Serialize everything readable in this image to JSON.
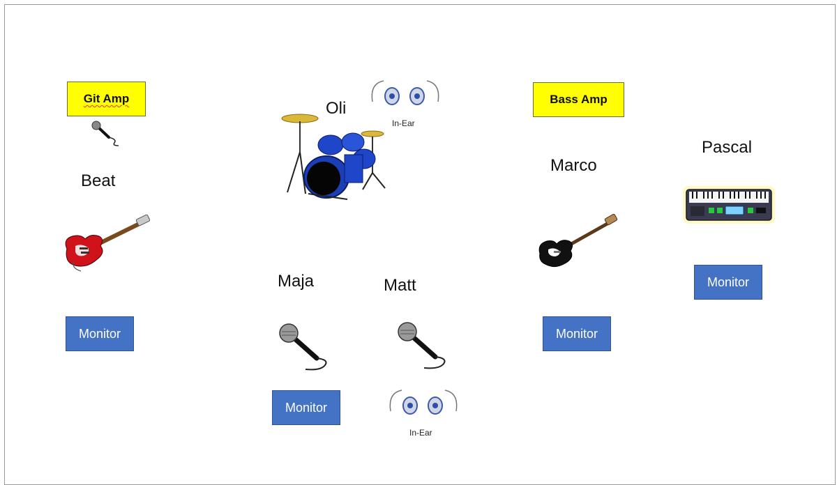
{
  "musicians": {
    "beat": "Beat",
    "oli": "Oli",
    "maja": "Maja",
    "matt": "Matt",
    "marco": "Marco",
    "pascal": "Pascal"
  },
  "amps": {
    "git_amp": "Git Amp",
    "bass_amp": "Bass Amp"
  },
  "monitor_label": "Monitor",
  "in_ear_label": "In-Ear",
  "colors": {
    "amp_fill": "#ffff00",
    "monitor_fill": "#4472c4",
    "monitor_text": "#ffffff"
  },
  "icons": [
    "microphone-icon",
    "electric-guitar-icon",
    "drum-kit-icon",
    "in-ear-monitor-icon",
    "bass-guitar-icon",
    "keyboard-icon"
  ]
}
